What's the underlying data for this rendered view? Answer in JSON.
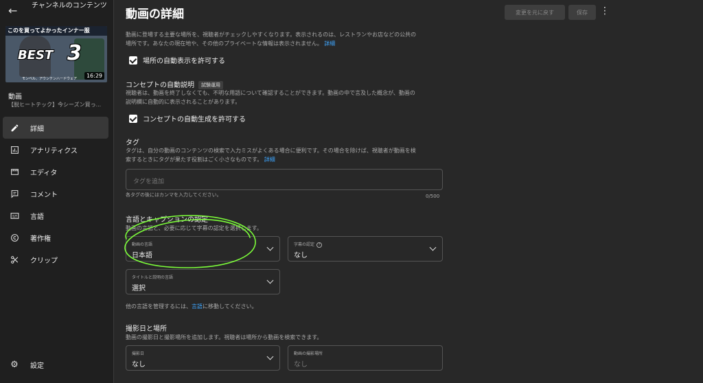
{
  "sidebar": {
    "back_icon": "arrow-left-icon",
    "channel_title": "チャンネルのコンテンツ",
    "thumbnail": {
      "banner": "このを買ってよかったインナー服",
      "best": "BEST",
      "number": "3",
      "subtext": "モンベル、アウンテンハードウェア",
      "duration": "16:29"
    },
    "video_label": "動画",
    "video_title": "【脱ヒートテック】今シーズン買っ...",
    "items": [
      {
        "label": "詳細",
        "icon": "pencil-icon"
      },
      {
        "label": "アナリティクス",
        "icon": "analytics-icon"
      },
      {
        "label": "エディタ",
        "icon": "editor-icon"
      },
      {
        "label": "コメント",
        "icon": "comment-icon"
      },
      {
        "label": "言語",
        "icon": "subtitles-icon"
      },
      {
        "label": "著作権",
        "icon": "copyright-icon"
      },
      {
        "label": "クリップ",
        "icon": "scissors-icon"
      }
    ],
    "settings_label": "設定"
  },
  "header": {
    "title": "動画の詳細",
    "undo_label": "変更を元に戻す",
    "save_label": "保存"
  },
  "location": {
    "desc_line1": "動画に登場する主要な場所を、視聴者がチェックしやすくなります。表示されるのは、レストランやお店などの公共の",
    "desc_line2": "場所です。あなたの現在地や、その他のプライベートな情報は表示されません。",
    "link": "詳細",
    "checkbox_label": "場所の自動表示を許可する"
  },
  "concept": {
    "title": "コンセプトの自動説明",
    "badge": "試験運用",
    "desc_line1": "視聴者は、動画を終了しなくても、不明な用語について確認することができます。動画の中で言及した概念が、動画の",
    "desc_line2": "説明欄に自動的に表示されることがあります。",
    "checkbox_label": "コンセプトの自動生成を許可する"
  },
  "tags": {
    "title": "タグ",
    "desc_line1": "タグは、自分の動画のコンテンツの検索で入力ミスがよくある場合に便利です。その場合を除けば、視聴者が動画を検",
    "desc_line2": "索するときにタグが果たす役割はごく小さなものです。",
    "link": "詳細",
    "placeholder": "タグを追加",
    "hint": "各タグの後にはカンマを入力してください。",
    "counter": "0/500"
  },
  "language": {
    "title": "言語とキャプションの認定",
    "desc": "動画の言語と、必要に応じて字幕の認定を選択します。",
    "video_lang_label": "動画の言語",
    "video_lang_value": "日本語",
    "caption_label": "字幕の認定",
    "caption_value": "なし",
    "title_lang_label": "タイトルと説明の言語",
    "title_lang_value": "選択",
    "manage_prefix": "他の言語を管理するには、",
    "manage_link": "言語",
    "manage_suffix": "に移動してください。"
  },
  "recording": {
    "title": "撮影日と場所",
    "desc": "動画の撮影日と撮影場所を追加します。視聴者は場所から動画を検索できます。",
    "date_label": "撮影日",
    "date_value": "なし",
    "location_label": "動画の撮影場所",
    "location_value": "なし"
  },
  "colors": {
    "background": "#282828",
    "sidebar": "#1f1f1f",
    "link": "#3ea6ff",
    "annotation": "#7dff3a"
  }
}
